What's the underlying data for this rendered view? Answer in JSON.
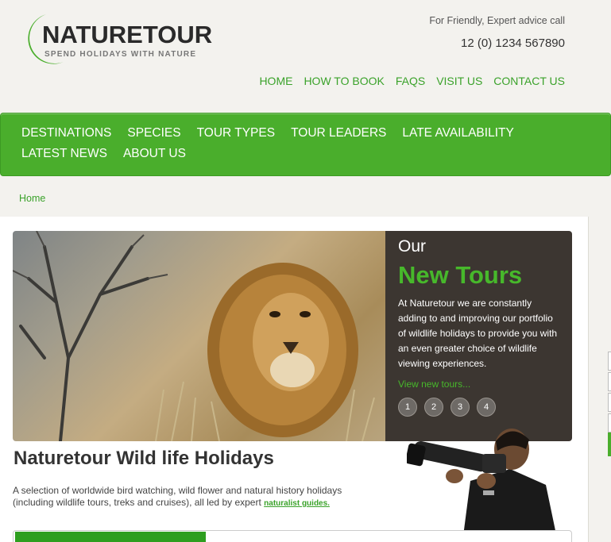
{
  "logo": {
    "title": "NATURETOUR",
    "tagline": "SPEND HOLIDAYS WITH NATURE"
  },
  "contact": {
    "label": "For Friendly, Expert advice call",
    "phone": "12 (0) 1234 567890"
  },
  "top_nav": [
    "HOME",
    "HOW TO BOOK",
    "FAQS",
    "VISIT US",
    "CONTACT US"
  ],
  "main_nav": [
    "DESTINATIONS",
    "SPECIES",
    "TOUR TYPES",
    "TOUR LEADERS",
    "LATE AVAILABILITY",
    "LATEST NEWS",
    "ABOUT US"
  ],
  "breadcrumb": "Home",
  "banner": {
    "our": "Our",
    "new_tours": "New Tours",
    "description": "At Naturetour we are constantly adding to and improving our portfolio of wildlife holidays to provide you with an even greater choice of wildlife viewing experiences.",
    "link": "View new tours...",
    "slides": [
      "1",
      "2",
      "3",
      "4"
    ]
  },
  "main": {
    "heading": "Naturetour Wild life Holidays",
    "intro": "A selection of worldwide bird watching, wild flower and natural history holidays (including wildlife tours, treks and cruises), all led by expert",
    "intro_link": "naturalist guides."
  },
  "colors": {
    "brand_green": "#4aae2c",
    "link_green": "#3aa22a",
    "panel_dark": "#3c3631"
  }
}
